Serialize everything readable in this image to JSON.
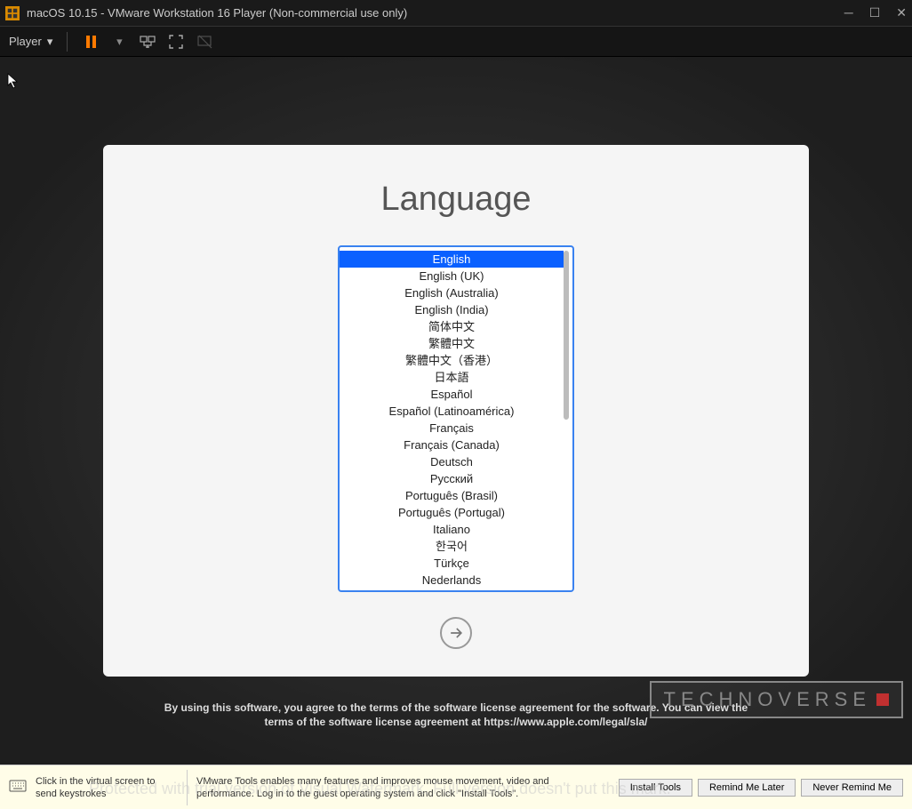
{
  "window": {
    "title": "macOS 10.15 - VMware Workstation 16 Player (Non-commercial use only)"
  },
  "toolbar": {
    "player_label": "Player"
  },
  "installer": {
    "title": "Language",
    "selected_index": 0,
    "languages": [
      "English",
      "English (UK)",
      "English (Australia)",
      "English (India)",
      "简体中文",
      "繁體中文",
      "繁體中文（香港）",
      "日本語",
      "Español",
      "Español (Latinoamérica)",
      "Français",
      "Français (Canada)",
      "Deutsch",
      "Русский",
      "Português (Brasil)",
      "Português (Portugal)",
      "Italiano",
      "한국어",
      "Türkçe",
      "Nederlands"
    ],
    "license_line1": "By using this software, you agree to the terms of the software license agreement for the software. You can view the",
    "license_line2": "terms of the software license agreement at https://www.apple.com/legal/sla/"
  },
  "bottombar": {
    "hint1": "Click in the virtual screen to send keystrokes",
    "hint2": "VMware Tools enables many features and improves mouse movement, video and performance. Log in to the guest operating system and click \"Install Tools\".",
    "install_label": "Install Tools",
    "remind_label": "Remind Me Later",
    "never_label": "Never Remind Me"
  },
  "watermark": {
    "brand": "TECHNOVERSE",
    "trial_text": "Protected with trial version of Visual Watermark. Full version doesn't put this mark."
  }
}
